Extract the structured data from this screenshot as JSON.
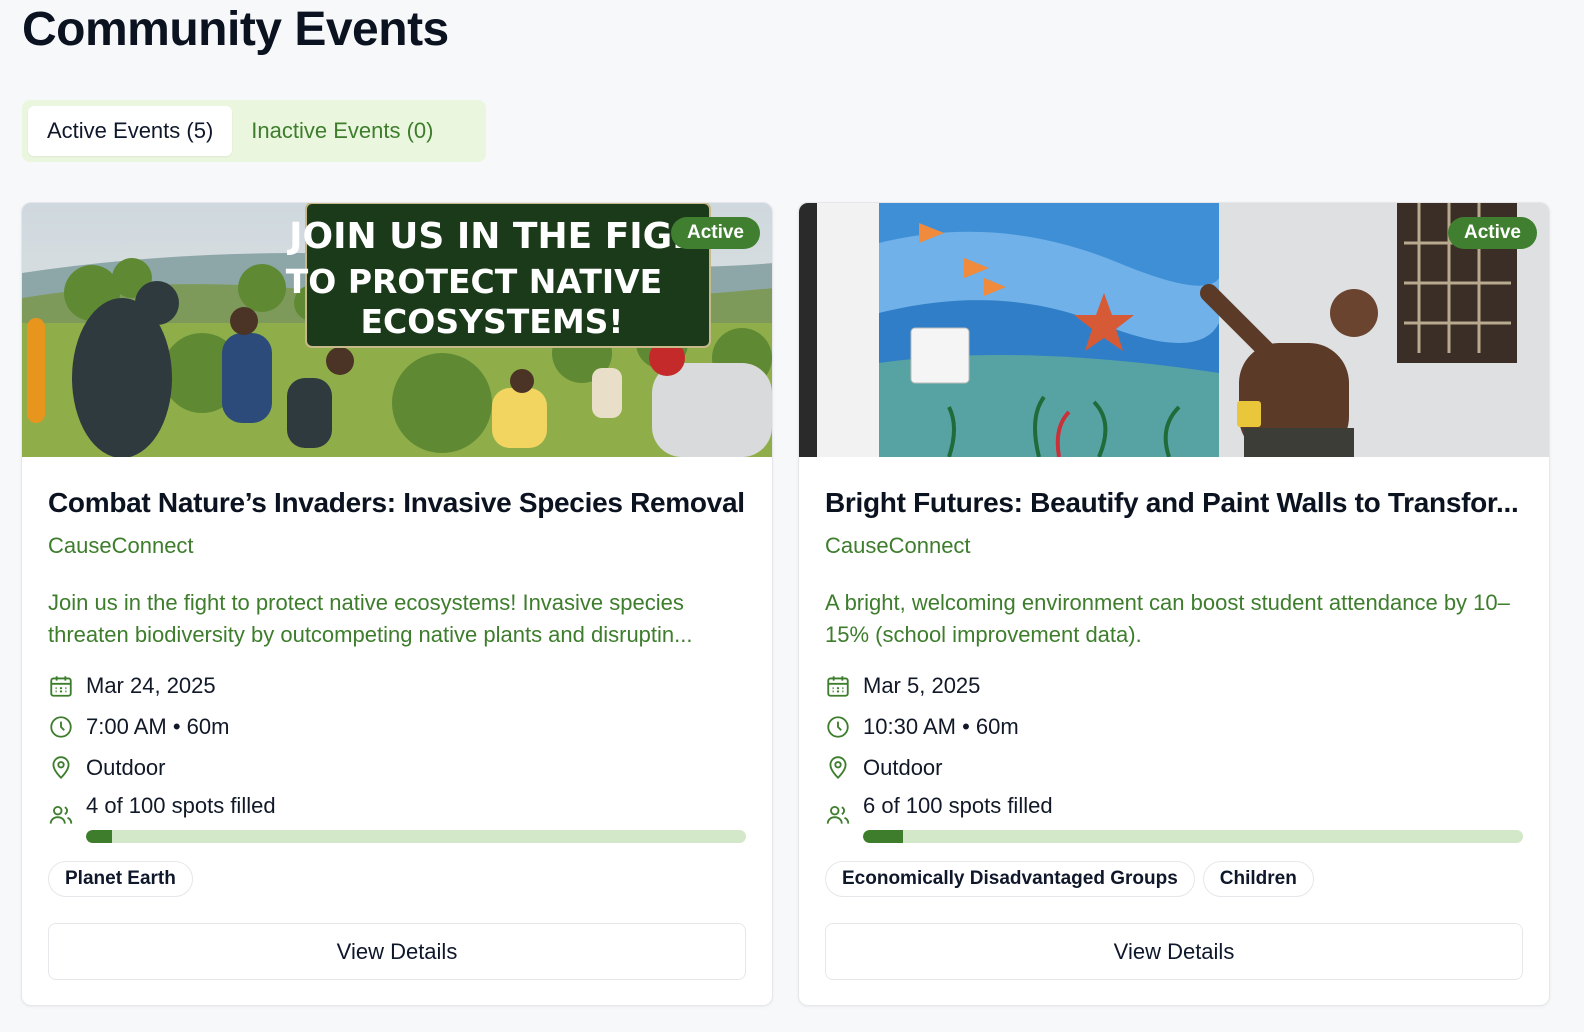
{
  "page": {
    "title": "Community Events"
  },
  "tabs": [
    {
      "label": "Active Events (5)",
      "selected": true
    },
    {
      "label": "Inactive Events (0)",
      "selected": false
    }
  ],
  "colors": {
    "accent": "#3d7d2c",
    "progress_track": "#d3e8c8",
    "tab_bg": "#eaf6de"
  },
  "events": [
    {
      "status": "Active",
      "image_banner": [
        "JOIN US IN THE FIGHT",
        "TO PROTECT NATIVE",
        "ECOSYSTEMS!"
      ],
      "title": "Combat Nature’s Invaders: Invasive Species Removal",
      "organizer": "CauseConnect",
      "description": "Join us in the fight to protect native ecosystems! Invasive species threaten biodiversity by outcompeting native plants and disruptin...",
      "date": "Mar 24, 2025",
      "time": "7:00 AM • 60m",
      "location": "Outdoor",
      "spots_label": "4 of 100 spots filled",
      "spots_fraction": 0.04,
      "tags": [
        "Planet Earth"
      ],
      "button": "View Details"
    },
    {
      "status": "Active",
      "title": "Bright Futures: Beautify and Paint Walls to Transfor...",
      "organizer": "CauseConnect",
      "description": "A bright, welcoming environment can boost student attendance by 10–15% (school improvement data).",
      "date": "Mar 5, 2025",
      "time": "10:30 AM • 60m",
      "location": "Outdoor",
      "spots_label": "6 of 100 spots filled",
      "spots_fraction": 0.06,
      "tags": [
        "Economically Disadvantaged Groups",
        "Children"
      ],
      "button": "View Details"
    }
  ]
}
